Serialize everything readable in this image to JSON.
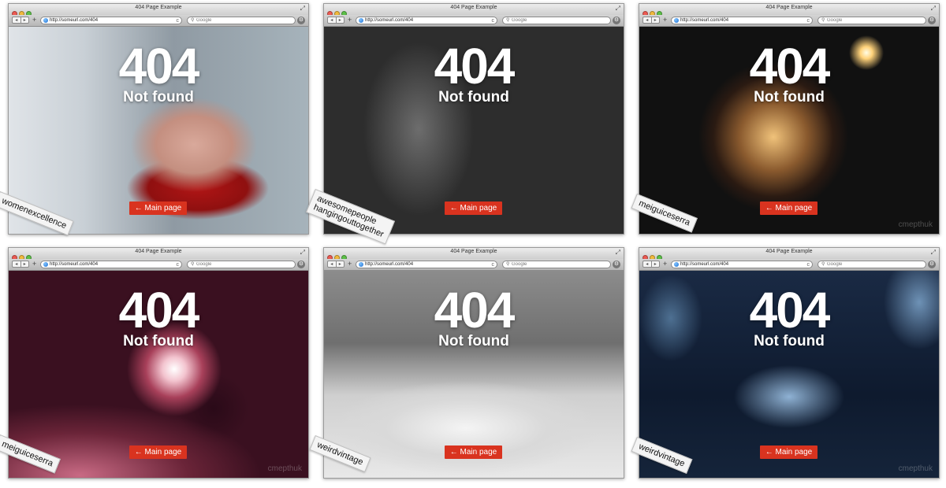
{
  "windows": [
    {
      "title": "404 Page Example",
      "url": "http://someurl.com/404",
      "search_placeholder": "Google",
      "heading": "404",
      "message": "Not found",
      "button": "← Main page",
      "credit": [
        "womenexcellence"
      ],
      "watermark": ""
    },
    {
      "title": "404 Page Example",
      "url": "http://someurl.com/404",
      "search_placeholder": "Google",
      "heading": "404",
      "message": "Not found",
      "button": "← Main page",
      "credit": [
        "awesomepeople",
        "hangingouttogether"
      ],
      "watermark": ""
    },
    {
      "title": "404 Page Example",
      "url": "http://someurl.com/404",
      "search_placeholder": "Google",
      "heading": "404",
      "message": "Not found",
      "button": "← Main page",
      "credit": [
        "meiguiceserra"
      ],
      "watermark": "cmepthuk"
    },
    {
      "title": "404 Page Example",
      "url": "http://someurl.com/404",
      "search_placeholder": "Google",
      "heading": "404",
      "message": "Not found",
      "button": "← Main page",
      "credit": [
        "meiguiceserra"
      ],
      "watermark": "cmepthuk"
    },
    {
      "title": "404 Page Example",
      "url": "http://someurl.com/404",
      "search_placeholder": "Google",
      "heading": "404",
      "message": "Not found",
      "button": "← Main page",
      "credit": [
        "weirdvintage"
      ],
      "watermark": ""
    },
    {
      "title": "404 Page Example",
      "url": "http://someurl.com/404",
      "search_placeholder": "Google",
      "heading": "404",
      "message": "Not found",
      "button": "← Main page",
      "credit": [
        "weirdvintage"
      ],
      "watermark": "cmepthuk"
    }
  ],
  "icons": {
    "back": "◂",
    "forward": "▸",
    "add_tab": "+",
    "reload": "c",
    "search": "⚲",
    "settings": "⚙",
    "expand": "⤢"
  },
  "colors": {
    "button_red": "#d9331f",
    "traffic_red": "#ec5a52",
    "traffic_yellow": "#f1b93c",
    "traffic_green": "#5cc047"
  }
}
